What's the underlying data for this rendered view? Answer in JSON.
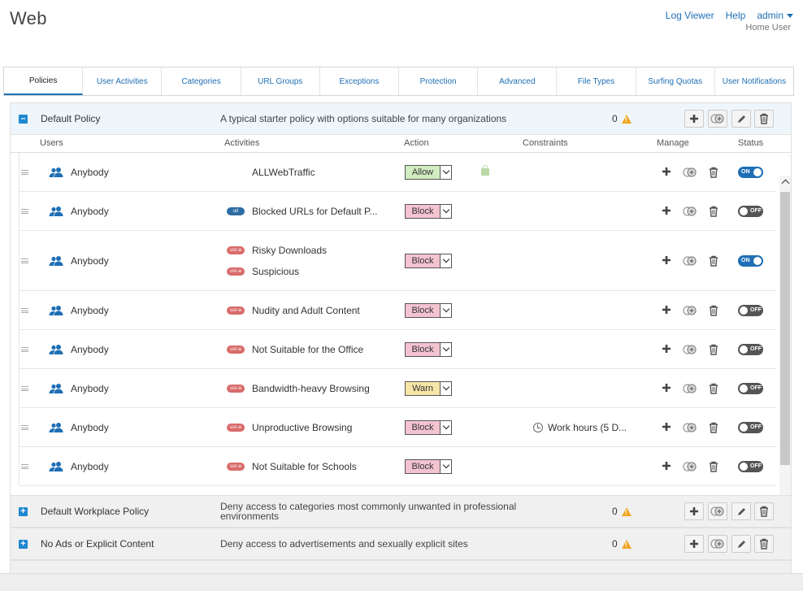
{
  "page": {
    "title": "Web"
  },
  "top_nav": {
    "log_viewer": "Log Viewer",
    "help": "Help",
    "user": "admin",
    "role": "Home User"
  },
  "tabs": [
    {
      "label": "Policies",
      "active": true
    },
    {
      "label": "User Activities"
    },
    {
      "label": "Categories"
    },
    {
      "label": "URL Groups"
    },
    {
      "label": "Exceptions"
    },
    {
      "label": "Protection"
    },
    {
      "label": "Advanced"
    },
    {
      "label": "File Types"
    },
    {
      "label": "Surfing Quotas"
    },
    {
      "label": "User Notifications"
    }
  ],
  "columns": {
    "users": "Users",
    "activities": "Activities",
    "action": "Action",
    "constraints": "Constraints",
    "manage": "Manage",
    "status": "Status"
  },
  "policies": [
    {
      "name": "Default Policy",
      "description": "A typical starter policy with options suitable for many organizations",
      "count": "0",
      "expanded": true
    },
    {
      "name": "Default Workplace Policy",
      "description": "Deny access to categories most commonly unwanted in professional environments",
      "count": "0",
      "expanded": false
    },
    {
      "name": "No Ads or Explicit Content",
      "description": "Deny access to advertisements and sexually explicit sites",
      "count": "0",
      "expanded": false
    }
  ],
  "rules": [
    {
      "user": "Anybody",
      "activities": [
        {
          "badge": "none",
          "label": "ALLWebTraffic"
        }
      ],
      "action": "Allow",
      "locked": true,
      "constraint": "",
      "status": "ON"
    },
    {
      "user": "Anybody",
      "activities": [
        {
          "badge": "url",
          "label": "Blocked URLs for Default P..."
        }
      ],
      "action": "Block",
      "constraint": "",
      "status": "OFF"
    },
    {
      "user": "Anybody",
      "activities": [
        {
          "badge": "cat",
          "label": "Risky Downloads"
        },
        {
          "badge": "cat",
          "label": "Suspicious"
        }
      ],
      "action": "Block",
      "constraint": "",
      "status": "ON"
    },
    {
      "user": "Anybody",
      "activities": [
        {
          "badge": "cat",
          "label": "Nudity and Adult Content"
        }
      ],
      "action": "Block",
      "constraint": "",
      "status": "OFF"
    },
    {
      "user": "Anybody",
      "activities": [
        {
          "badge": "cat",
          "label": "Not Suitable for the Office"
        }
      ],
      "action": "Block",
      "constraint": "",
      "status": "OFF"
    },
    {
      "user": "Anybody",
      "activities": [
        {
          "badge": "cat",
          "label": "Bandwidth-heavy Browsing"
        }
      ],
      "action": "Warn",
      "constraint": "",
      "status": "OFF"
    },
    {
      "user": "Anybody",
      "activities": [
        {
          "badge": "cat",
          "label": "Unproductive Browsing"
        }
      ],
      "action": "Block",
      "constraint": "Work hours (5 D...",
      "status": "OFF"
    },
    {
      "user": "Anybody",
      "activities": [
        {
          "badge": "cat",
          "label": "Not Suitable for Schools"
        }
      ],
      "action": "Block",
      "constraint": "",
      "status": "OFF"
    }
  ],
  "badge_text": {
    "url": "url",
    "cat": "usr-a"
  },
  "colors": {
    "accent": "#1e6fb5",
    "allow": "#d2ecc1",
    "block": "#f4c3d2",
    "warn": "#f7e5a8",
    "warning_icon": "#f0a520"
  }
}
